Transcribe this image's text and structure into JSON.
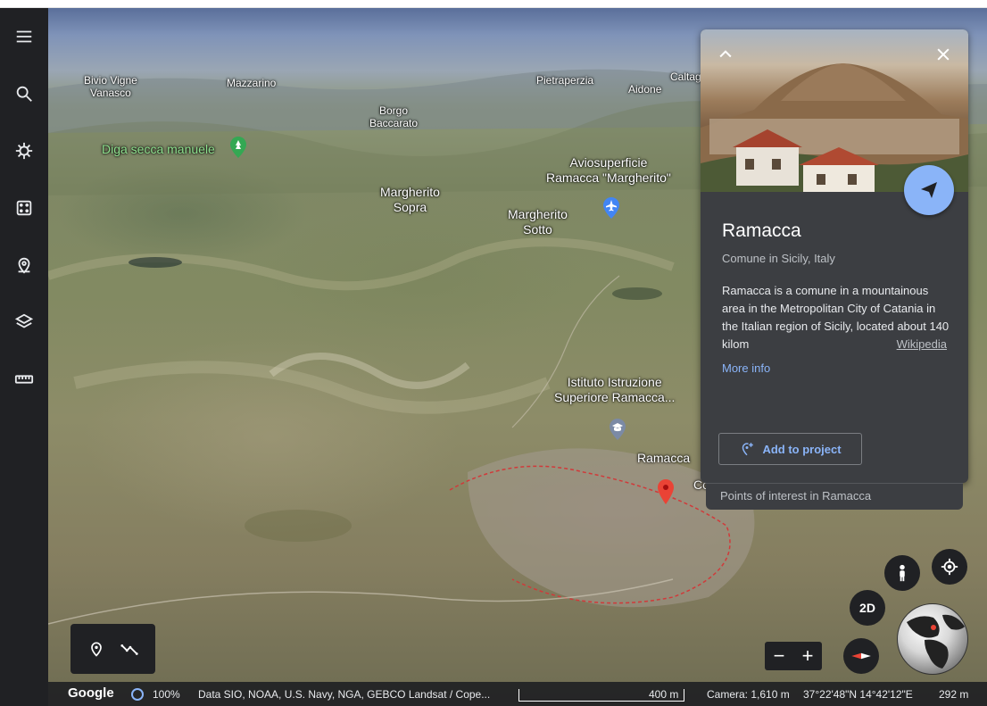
{
  "sidebar": {
    "items": [
      {
        "icon": "menu-icon"
      },
      {
        "icon": "search-icon"
      },
      {
        "icon": "voyager-icon"
      },
      {
        "icon": "dice-icon"
      },
      {
        "icon": "projects-icon"
      },
      {
        "icon": "layers-icon"
      },
      {
        "icon": "measure-icon"
      }
    ]
  },
  "map": {
    "labels": [
      {
        "text": "Bivio Vigne\nVanasco"
      },
      {
        "text": "Mazzarino"
      },
      {
        "text": "Borgo\nBaccarato"
      },
      {
        "text": "Pietraperzia"
      },
      {
        "text": "Aidone"
      },
      {
        "text": "Caltag"
      },
      {
        "text": "Diga secca manuele"
      },
      {
        "text": "Aviosuperficie\nRamacca \"Margherito\""
      },
      {
        "text": "Margherito\nSopra"
      },
      {
        "text": "Margherito\nSotto"
      },
      {
        "text": "Istituto Istruzione\nSuperiore Ramacca..."
      },
      {
        "text": "Ramacca"
      },
      {
        "text": "Co"
      }
    ]
  },
  "panel": {
    "title": "Ramacca",
    "subtitle": "Comune in Sicily, Italy",
    "description": "Ramacca is a comune in a mountainous area in the Metropolitan City of Catania in the Italian region of Sicily, located about 140 kilom",
    "wiki_link": "Wikipedia",
    "more_info": "More info",
    "add_to_project": "Add to project",
    "poi": "Points of interest in Ramacca"
  },
  "controls": {
    "view_2d": "2D",
    "zoom_out": "−",
    "zoom_in": "+"
  },
  "status": {
    "brand": "Google",
    "load_percent": "100%",
    "attribution": "Data SIO, NOAA, U.S. Navy, NGA, GEBCO  Landsat / Cope...",
    "scale": "400 m",
    "camera": "Camera: 1,610 m",
    "coords": "37°22'48\"N 14°42'12\"E",
    "elevation": "292 m"
  },
  "colors": {
    "sidebar_bg": "#202124",
    "panel_bg": "#3c3e42",
    "accent": "#8ab4f8"
  }
}
